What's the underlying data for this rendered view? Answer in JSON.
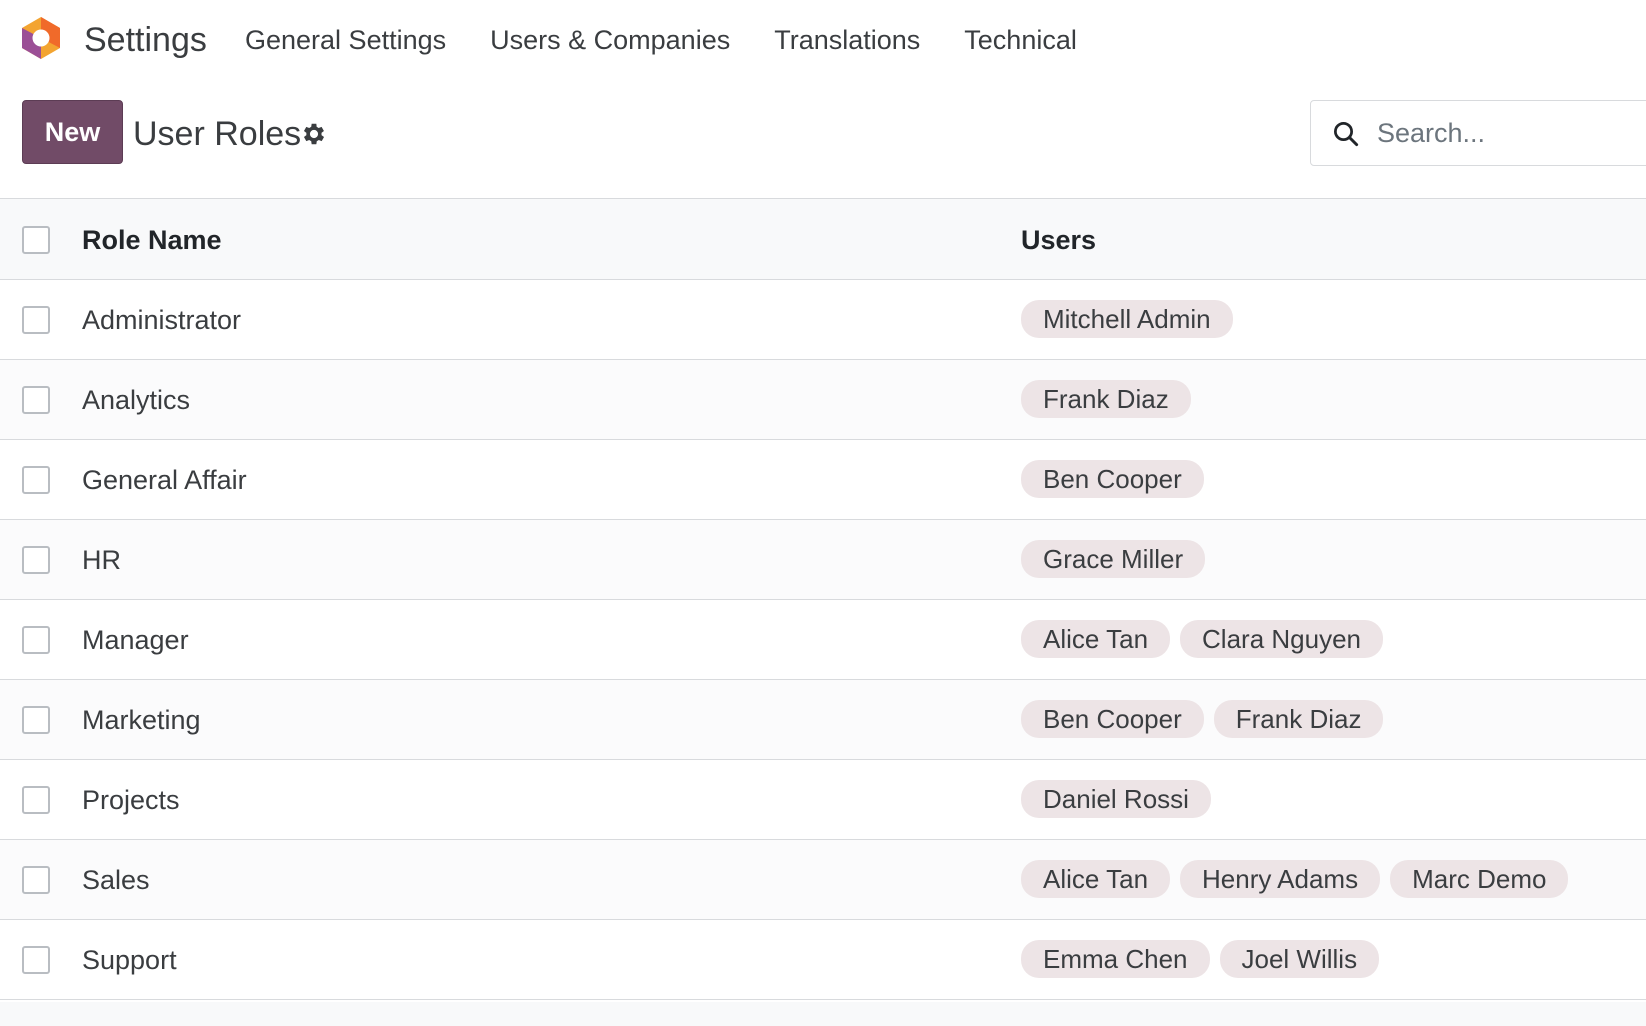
{
  "navbar": {
    "app_title": "Settings",
    "menu": [
      {
        "label": "General Settings"
      },
      {
        "label": "Users & Companies"
      },
      {
        "label": "Translations"
      },
      {
        "label": "Technical"
      }
    ]
  },
  "control_panel": {
    "new_label": "New",
    "title": "User Roles",
    "search_placeholder": "Search..."
  },
  "colors": {
    "brand": "#714b67",
    "tag_bg": "#ede4e6",
    "logo_orange": "#f3a431",
    "logo_purple": "#9b4f96"
  },
  "icons": {
    "logo": "odoo-settings-logo-icon",
    "gear": "gear-icon",
    "search": "search-icon"
  },
  "table": {
    "headers": {
      "name": "Role Name",
      "users": "Users"
    },
    "rows": [
      {
        "name": "Administrator",
        "users": [
          "Mitchell Admin"
        ]
      },
      {
        "name": "Analytics",
        "users": [
          "Frank Diaz"
        ]
      },
      {
        "name": "General Affair",
        "users": [
          "Ben Cooper"
        ]
      },
      {
        "name": "HR",
        "users": [
          "Grace Miller"
        ]
      },
      {
        "name": "Manager",
        "users": [
          "Alice Tan",
          "Clara Nguyen"
        ]
      },
      {
        "name": "Marketing",
        "users": [
          "Ben Cooper",
          "Frank Diaz"
        ]
      },
      {
        "name": "Projects",
        "users": [
          "Daniel Rossi"
        ]
      },
      {
        "name": "Sales",
        "users": [
          "Alice Tan",
          "Henry Adams",
          "Marc Demo"
        ]
      },
      {
        "name": "Support",
        "users": [
          "Emma Chen",
          "Joel Willis"
        ]
      }
    ]
  }
}
